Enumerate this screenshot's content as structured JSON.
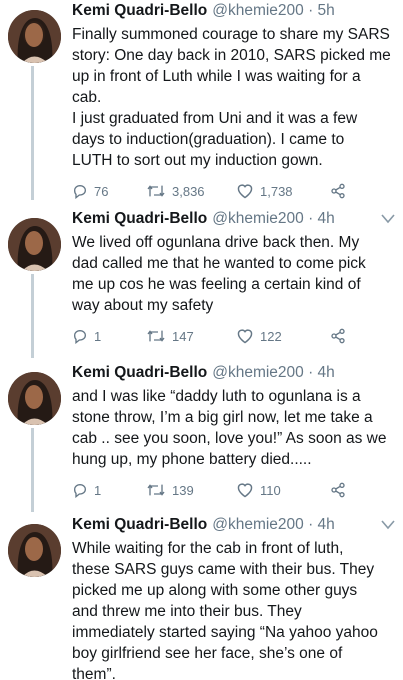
{
  "tweets": [
    {
      "name": "Kemi Quadri-Bello",
      "handle": "@khemie200 · 5h",
      "text": "Finally summoned courage to share my SARS\nstory: One day back in 2010, SARS picked me\nup in front of Luth while I was waiting for a\ncab.\nI just graduated from Uni and it was a few\ndays to induction(graduation). I came to\nLUTH to sort out my induction gown.",
      "replies": "76",
      "retweets": "3,836",
      "likes": "1,738"
    },
    {
      "name": "Kemi Quadri-Bello",
      "handle": "@khemie200 · 4h",
      "text": "We lived off ogunlana drive back then. My\ndad called me that he wanted to come pick\nme up cos he was feeling a certain kind of\nway about my safety",
      "replies": "1",
      "retweets": "147",
      "likes": "122"
    },
    {
      "name": "Kemi Quadri-Bello",
      "handle": "@khemie200 · 4h",
      "text": "and I was like “daddy luth to ogunlana is a\nstone throw, I’m a big girl now, let me take a\ncab .. see you soon, love you!” As soon as we\nhung up, my phone battery died.....",
      "replies": "1",
      "retweets": "139",
      "likes": "110"
    },
    {
      "name": "Kemi Quadri-Bello",
      "handle": "@khemie200 · 4h",
      "text": "While waiting for the cab in front of luth,\nthese SARS guys came with their bus. They\npicked me up along with some other guys\nand threw me into their bus. They\nimmediately started saying “Na yahoo yahoo\nboy girlfriend see her face, she’s one of\nthem”."
    }
  ],
  "icons": {
    "reply": "reply-icon",
    "retweet": "retweet-icon",
    "like": "like-icon",
    "share": "share-icon",
    "menu": "chevron-down-icon"
  },
  "colors": {
    "text": "#14171a",
    "muted": "#657786",
    "line": "#c4cfd6"
  }
}
